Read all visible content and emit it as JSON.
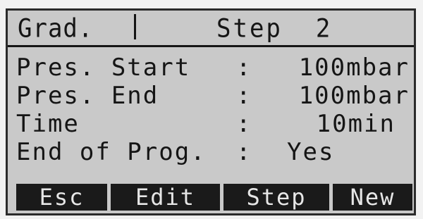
{
  "header": {
    "mode": "Grad.",
    "step": "Step  2"
  },
  "rows": [
    {
      "label": "Pres. Start",
      "colon": ":",
      "value": "100mbar"
    },
    {
      "label": "Pres. End",
      "colon": ":",
      "value": "100mbar"
    },
    {
      "label": "Time",
      "colon": ":",
      "value": "10min"
    },
    {
      "label": "End of Prog.",
      "colon": ":",
      "value": "Yes"
    }
  ],
  "softkeys": {
    "esc": "Esc",
    "edit": "Edit",
    "step": "Step",
    "new": "New"
  },
  "colors": {
    "lcd_background": "#c9c9c9",
    "text": "#151515",
    "softkey_background": "#1a1a1a",
    "softkey_text": "#e6e6e6"
  }
}
